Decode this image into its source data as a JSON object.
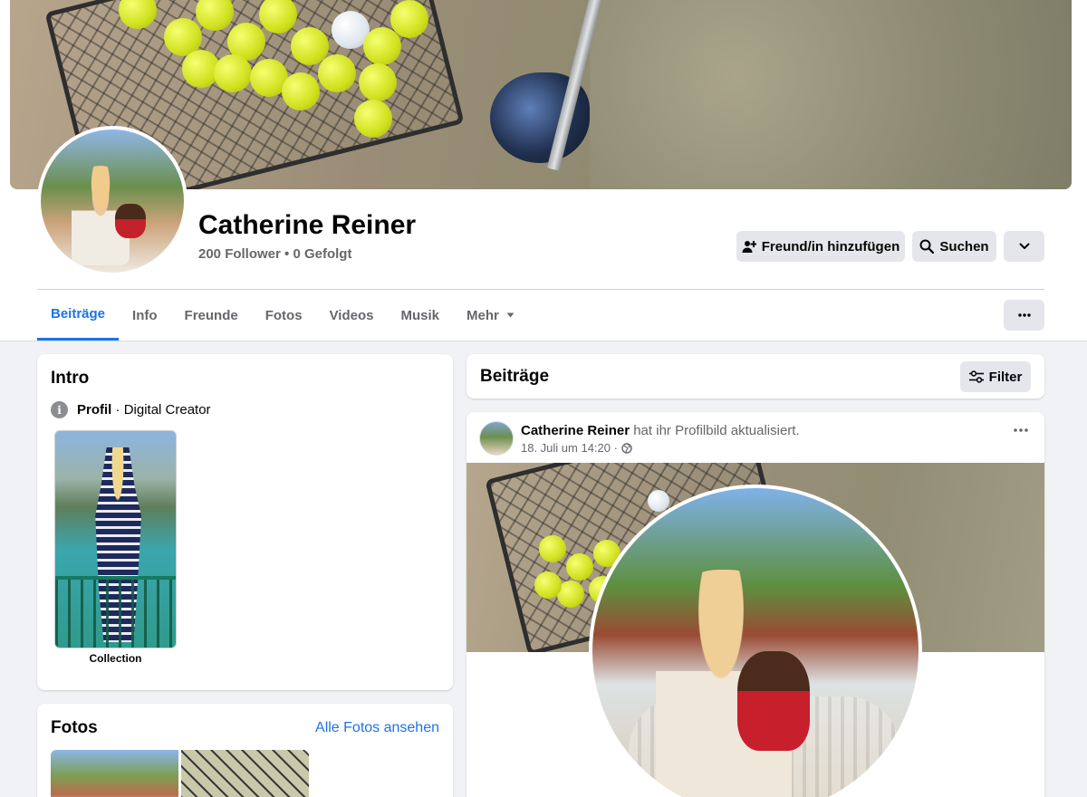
{
  "profile": {
    "name": "Catherine Reiner",
    "stats": "200 Follower • 0 Gefolgt"
  },
  "actions": {
    "add_friend": "Freund/in hinzufügen",
    "search": "Suchen"
  },
  "tabs": [
    {
      "label": "Beiträge",
      "active": true
    },
    {
      "label": "Info"
    },
    {
      "label": "Freunde"
    },
    {
      "label": "Fotos"
    },
    {
      "label": "Videos"
    },
    {
      "label": "Musik"
    },
    {
      "label": "Mehr"
    }
  ],
  "intro": {
    "title": "Intro",
    "profile_label": "Profil",
    "profile_separator": "·",
    "category": "Digital Creator",
    "info_icon": "i",
    "collection_label": "Collection"
  },
  "fotos": {
    "title": "Fotos",
    "link": "Alle Fotos ansehen"
  },
  "posts": {
    "title": "Beiträge",
    "filter": "Filter",
    "item": {
      "author": "Catherine Reiner",
      "action": "hat ihr Profilbild aktualisiert.",
      "date": "18. Juli um 14:20 ·"
    }
  },
  "colors": {
    "accent": "#1b74e4",
    "button_bg": "#e4e6eb",
    "page_bg": "#f0f2f5",
    "secondary_text": "#65676b"
  }
}
